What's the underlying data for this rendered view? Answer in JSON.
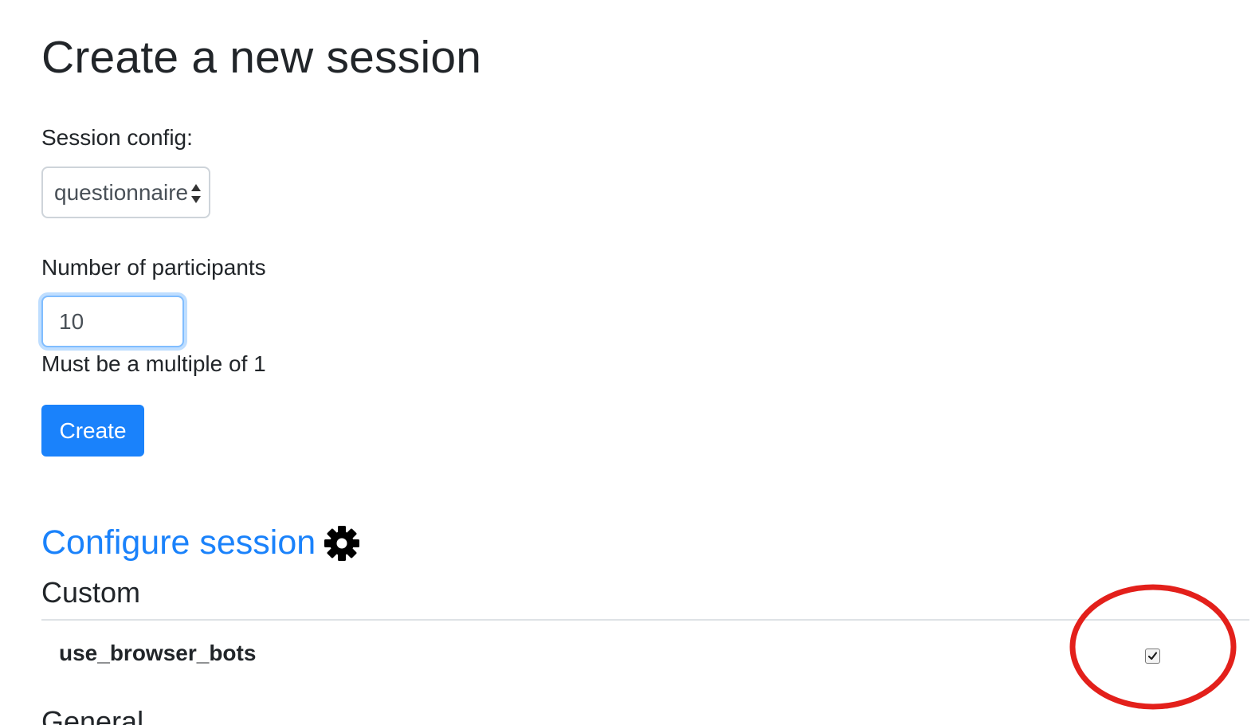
{
  "header": {
    "title": "Create a new session"
  },
  "form": {
    "session_config_label": "Session config:",
    "session_config_selected": "questionnaire",
    "participants_label": "Number of participants",
    "participants_value": "10",
    "participants_help": "Must be a multiple of 1",
    "create_label": "Create"
  },
  "configure": {
    "link_label": "Configure session",
    "section_custom": "Custom",
    "rows": [
      {
        "name": "use_browser_bots",
        "checked": true
      }
    ],
    "next_section_label": "General"
  },
  "colors": {
    "primary": "#1a82fb",
    "text": "#212529",
    "focus_border": "#80bdff",
    "annotation": "#e3201b"
  },
  "icons": {
    "configure": "gear-icon",
    "select": "select-arrows-icon",
    "checkbox": "checkmark-icon"
  }
}
